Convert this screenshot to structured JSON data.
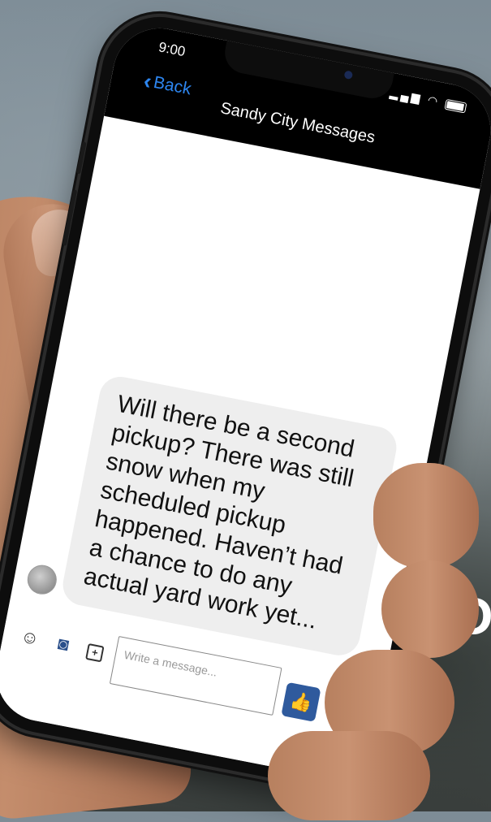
{
  "status_bar": {
    "time": "9:00",
    "signal_icon": "signal-icon",
    "wifi_icon": "wifi-icon",
    "battery_icon": "battery-icon"
  },
  "nav": {
    "back_label": "Back",
    "back_icon": "chevron-left-icon",
    "title": "Sandy City Messages"
  },
  "message": {
    "text": "Will there be a second pickup? There was still snow when my scheduled pickup happened. Haven’t had a chance to do any actual yard work yet..."
  },
  "composer": {
    "placeholder": "Write a message...",
    "tools": [
      "smiley-icon",
      "camera-icon",
      "sticker-icon"
    ],
    "send_icon": "thumbs-up-icon"
  },
  "background_text": "D",
  "colors": {
    "accent": "#2d86f0",
    "like_button": "#2f5a9d",
    "bubble": "#eeeeee",
    "status_bar": "#000000"
  }
}
